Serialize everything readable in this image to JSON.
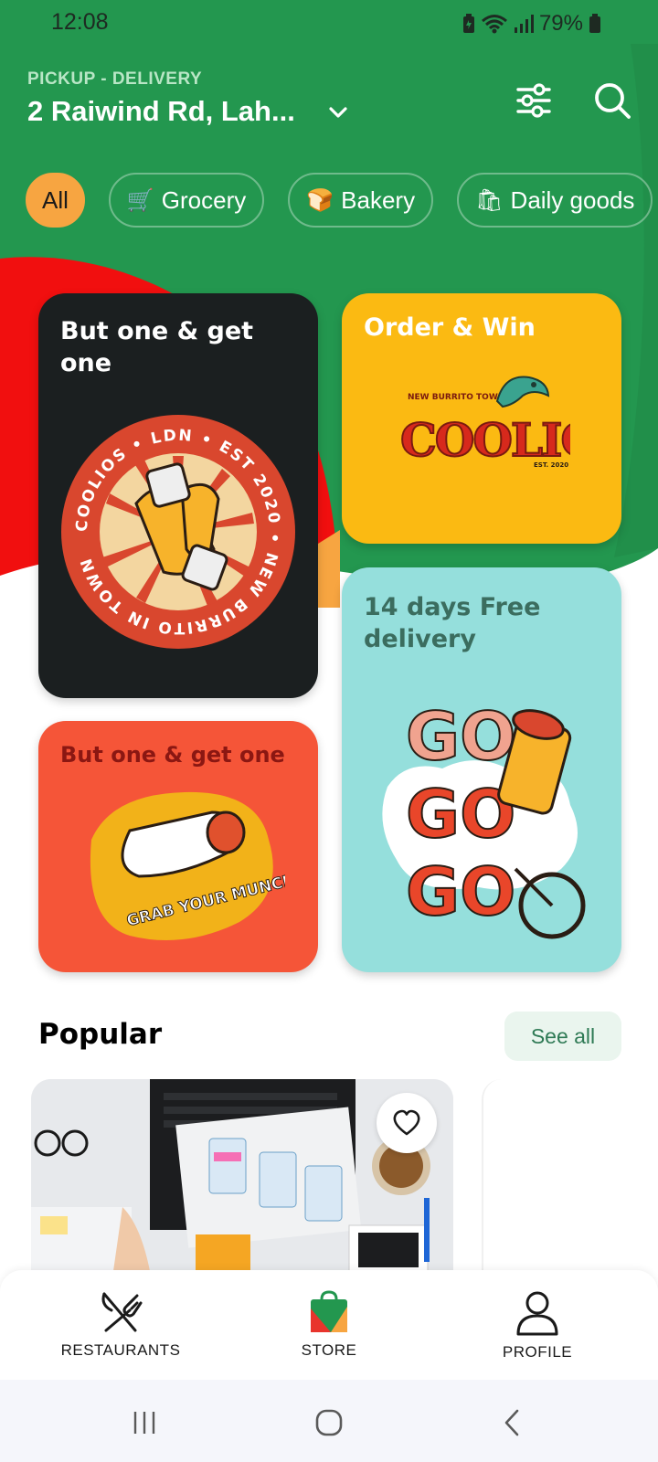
{
  "status_bar": {
    "time": "12:08",
    "battery": "79%"
  },
  "header": {
    "mode_label": "PICKUP - DELIVERY",
    "address": "2 Raiwind Rd, Lah...",
    "icons": [
      "chevron-down-icon",
      "filter-sliders-icon",
      "search-icon"
    ]
  },
  "categories": [
    {
      "label": "All",
      "emoji": "",
      "active": true
    },
    {
      "label": "Grocery",
      "emoji": "🛒",
      "active": false
    },
    {
      "label": "Bakery",
      "emoji": "🍞",
      "active": false
    },
    {
      "label": "Daily goods",
      "emoji": "🛍",
      "active": false
    }
  ],
  "promos": [
    {
      "title": "But one & get one",
      "color": "#1b1f20"
    },
    {
      "title": "Order & Win",
      "color": "#fbba12"
    },
    {
      "title": "But one & get one",
      "color": "#f55538"
    },
    {
      "title": "14 days Free delivery",
      "color": "#95dfdc"
    }
  ],
  "artwork_text": {
    "badge_ring": "COOLIOS • LDN • EST 2020 • NEW BURRITO IN TOWN",
    "coolios_small": "NEW BURRITO TOWN",
    "coolios_big": "COOLIOS",
    "coolios_est": "EST. 2020",
    "munchies": "GRAB YOUR MUNCHIES",
    "go": "GO"
  },
  "popular": {
    "title": "Popular",
    "see_all": "See all"
  },
  "bottom_nav": [
    {
      "label": "RESTAURANTS",
      "icon": "fork-knife-icon"
    },
    {
      "label": "STORE",
      "icon": "store-bag-icon"
    },
    {
      "label": "PROFILE",
      "icon": "person-icon"
    }
  ],
  "colors": {
    "header_green": "#23974f",
    "accent_orange": "#f7a541",
    "hero_red": "#f10f0f"
  }
}
